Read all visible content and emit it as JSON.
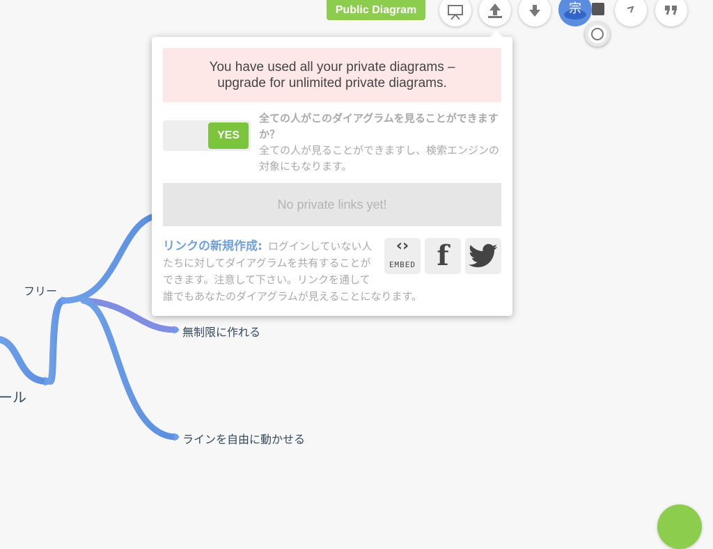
{
  "toolbar": {
    "badge_label": "Public Diagram",
    "user_initial": "宗",
    "buttons": [
      "presentation-icon",
      "upload-icon",
      "download-icon",
      "user-avatar",
      "edit-icon",
      "quote-icon"
    ]
  },
  "popup": {
    "alert_line1": "You have used all your private diagrams –",
    "alert_line2": "upgrade for unlimited private diagrams.",
    "toggle_label": "YES",
    "visibility_question": "全ての人がこのダイアグラムを見ることができますか？",
    "visibility_description": "全ての人が見ることができますし、検索エンジンの対象にもなります。",
    "no_links": "No private links yet!",
    "new_link_label": "リンクの新規作成:",
    "new_link_description": "ログインしていない人たちに対してダイアグラムを共有することができます。注意して下さい。リンクを通して誰でもあなたのダイアグラムが見えることになります。",
    "share": {
      "embed_glyph": "‹›",
      "embed_label": "EMBED",
      "facebook_glyph": "f"
    }
  },
  "mindmap": {
    "free_node": "フリー",
    "tool_node": "ツール",
    "unlimited_node": "無制限に作れる",
    "lines_node": "ラインを自由に動かせる"
  },
  "colors": {
    "badge_green": "#8dcd4e",
    "toggle_green": "#7bc43c",
    "alert_bg": "#fde7e7",
    "branch_blue": "#6f9de8",
    "link_blue": "#6fa0e0",
    "avatar_blue": "#5a8de0"
  }
}
